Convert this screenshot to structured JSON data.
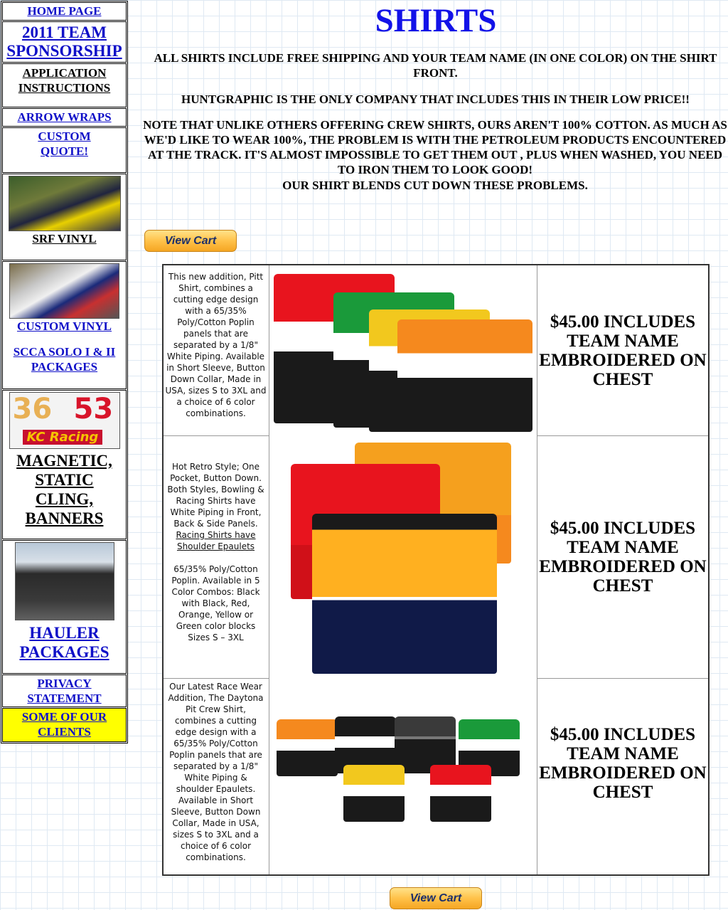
{
  "sidebar": {
    "home": "HOME PAGE",
    "team_sponsorship": "2011 TEAM SPONSORSHIP",
    "application_instructions": "APPLICATION INSTRUCTIONS",
    "arrow_wraps": "ARROW WRAPS",
    "custom_quote": "CUSTOM QUOTE!",
    "srf_vinyl": "SRF VINYL",
    "custom_vinyl": "CUSTOM VINYL",
    "scca_packages": "SCCA SOLO I & II PACKAGES",
    "kc_numbers": [
      "36",
      "53"
    ],
    "kc_logo": "KC Racing",
    "magnetic": "MAGNETIC, STATIC CLING, BANNERS",
    "hauler": "HAULER PACKAGES",
    "privacy": "PRIVACY STATEMENT",
    "clients": "SOME OF OUR CLIENTS"
  },
  "page": {
    "title": "SHIRTS",
    "intro1": "ALL SHIRTS INCLUDE FREE SHIPPING AND YOUR TEAM NAME (IN ONE COLOR) ON THE SHIRT FRONT.",
    "intro2": "HUNTGRAPHIC IS THE ONLY COMPANY THAT INCLUDES THIS IN THEIR LOW PRICE!!",
    "intro3": "NOTE THAT UNLIKE OTHERS OFFERING CREW SHIRTS, OURS AREN'T 100% COTTON. AS MUCH AS WE'D LIKE TO WEAR 100%, THE PROBLEM IS WITH THE PETROLEUM PRODUCTS ENCOUNTERED AT THE TRACK. IT'S ALMOST IMPOSSIBLE TO GET THEM OUT , PLUS WHEN WASHED, YOU NEED TO IRON THEM TO LOOK GOOD!",
    "intro4": "OUR SHIRT BLENDS CUT DOWN THESE PROBLEMS.",
    "view_cart": "View Cart"
  },
  "products": [
    {
      "description": "This new addition, Pitt Shirt, combines a cutting edge design with a 65/35% Poly/Cotton Poplin panels that are separated by a 1/8\" White Piping. Available in Short Sleeve, Button Down Collar, Made in USA, sizes S to 3XL and a choice of 6 color combinations.",
      "price": "$45.00 INCLUDES TEAM NAME EMBROIDERED ON CHEST"
    },
    {
      "description_a": "Hot Retro Style; One Pocket, Button Down. Both Styles, Bowling & Racing Shirts have White Piping in Front, Back & Side Panels.",
      "description_link": "Racing Shirts have Shoulder Epaulets",
      "description_b": "65/35% Poly/Cotton Poplin. Available in 5 Color Combos: Black with Black, Red, Orange, Yellow or Green color blocks Sizes S – 3XL",
      "price": "$45.00 INCLUDES TEAM NAME EMBROIDERED ON CHEST"
    },
    {
      "description": "Our Latest Race Wear Addition, The Daytona Pit Crew Shirt, combines a cutting edge design with a 65/35% Poly/Cotton Poplin panels that are separated by a 1/8\" White Piping & shoulder Epaulets. Available in Short Sleeve, Button Down Collar, Made in USA, sizes S to 3XL and a choice of 6 color combinations.",
      "price": "$45.00 INCLUDES TEAM NAME EMBROIDERED ON CHEST"
    }
  ],
  "colors": {
    "link": "#1010c8",
    "title": "#1212e8",
    "clients_bg": "#ffff00",
    "shirt_red": "#e8141e",
    "shirt_green": "#1a9a3a",
    "shirt_yellow": "#f2c81e",
    "shirt_orange": "#f5891e",
    "shirt_black": "#1a1a1a"
  }
}
